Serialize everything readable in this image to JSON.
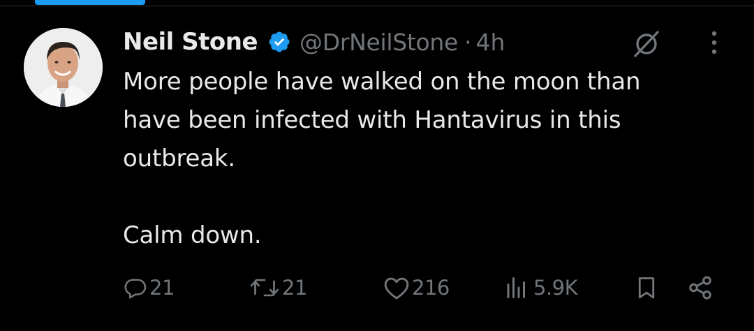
{
  "post": {
    "author_name": "Neil Stone",
    "handle": "@DrNeilStone",
    "separator": "·",
    "time": "4h",
    "text_lines": [
      "More people have walked on the moon than",
      "have been infected with Hantavirus in this",
      "outbreak.",
      "Calm down."
    ]
  },
  "actions": {
    "replies": "21",
    "reposts": "21",
    "likes": "216",
    "views": "5.9K"
  },
  "icons": {
    "verified": "verified-badge-icon",
    "grok": "grok-icon",
    "more": "more-vertical-icon",
    "reply": "reply-icon",
    "repost": "repost-icon",
    "like": "heart-icon",
    "views": "views-icon",
    "bookmark": "bookmark-icon",
    "share": "share-icon"
  },
  "colors": {
    "background": "#000000",
    "text": "#e7e9ea",
    "secondary": "#71767b",
    "accent": "#1d9bf0"
  }
}
